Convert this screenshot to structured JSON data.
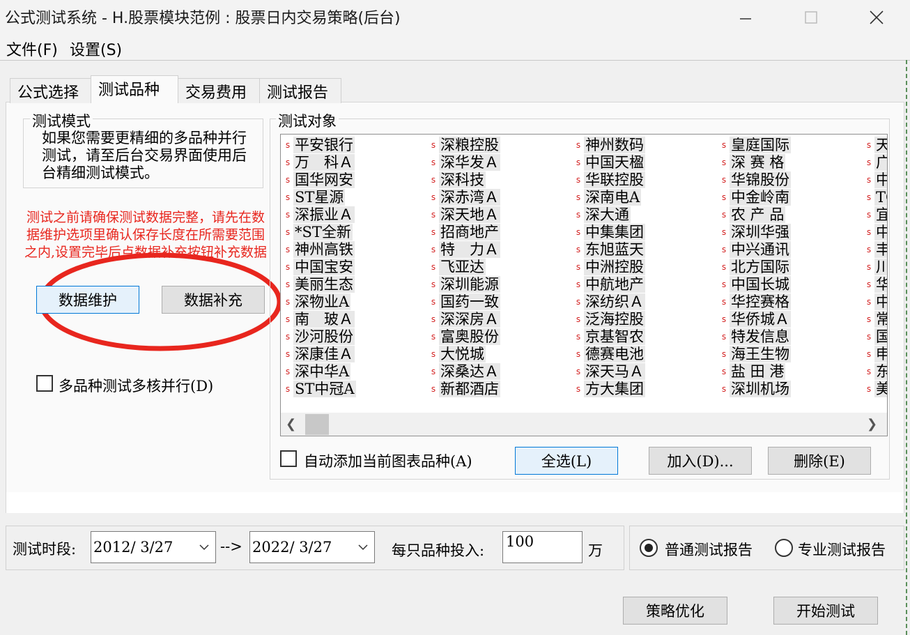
{
  "window": {
    "title": "公式测试系统 - H.股票模块范例 : 股票日内交易策略(后台)",
    "controls": [
      "minimize-icon",
      "maximize-icon",
      "close-icon"
    ]
  },
  "menu": {
    "file": "文件(F)",
    "settings": "设置(S)"
  },
  "tabs": [
    {
      "label": "公式选择",
      "active": false
    },
    {
      "label": "测试品种",
      "active": true
    },
    {
      "label": "交易费用",
      "active": false
    },
    {
      "label": "测试报告",
      "active": false
    }
  ],
  "mode": {
    "title": "测试模式",
    "description": "如果您需要更精细的多品种并行测试，请至后台交易界面使用后台精细测试模式。"
  },
  "notice": "测试之前请确保测试数据完整，请先在数据维护选项里确认保存长度在所需要范围之内,设置完毕后点数据补充按钮补充数据",
  "buttons": {
    "maintain": "数据维护",
    "supplement": "数据补充",
    "select_all": "全选(L)",
    "add": "加入(D)...",
    "delete": "删除(E)",
    "optimize": "策略优化",
    "start": "开始测试"
  },
  "multi_core": {
    "label": "多品种测试多核并行(D)",
    "checked": false
  },
  "objects": {
    "title": "测试对象",
    "mark": "s",
    "columns": [
      [
        "平安银行",
        "万　科Ａ",
        "国华网安",
        "ST星源",
        "深振业Ａ",
        "*ST全新",
        "神州高铁",
        "中国宝安",
        "美丽生态",
        "深物业A",
        "南　玻Ａ",
        "沙河股份",
        "深康佳Ａ",
        "深中华A",
        "ST中冠A"
      ],
      [
        "深粮控股",
        "深华发Ａ",
        "深科技",
        "深赤湾Ａ",
        "深天地Ａ",
        "招商地产",
        "特　力Ａ",
        "飞亚达",
        "深圳能源",
        "国药一致",
        "深深房Ａ",
        "富奥股份",
        "大悦城",
        "深桑达Ａ",
        "新都酒店"
      ],
      [
        "神州数码",
        "中国天楹",
        "华联控股",
        "深南电A",
        "深大通",
        "中集集团",
        "东旭蓝天",
        "中洲控股",
        "中航地产",
        "深纺织Ａ",
        "泛海控股",
        "京基智农",
        "德赛电池",
        "深天马Ａ",
        "方大集团"
      ],
      [
        "皇庭国际",
        "深 赛 格",
        "华锦股份",
        "中金岭南",
        "农 产 品",
        "深圳华强",
        "中兴通讯",
        "北方国际",
        "中国长城",
        "华控赛格",
        "华侨城Ａ",
        "特发信息",
        "海王生物",
        "盐 田 港",
        "深圳机场"
      ],
      [
        "天",
        "广",
        "中",
        "TC",
        "宜",
        "中",
        "丰",
        "川",
        "华",
        "中",
        "常",
        "国",
        "申",
        "东",
        "美"
      ]
    ]
  },
  "auto_add": {
    "label": "自动添加当前图表品种(A)",
    "checked": false
  },
  "period": {
    "label": "测试时段:",
    "start": "2012/ 3/27",
    "arrow": "-->",
    "end": "2022/ 3/27"
  },
  "investment": {
    "label": "每只品种投入:",
    "value": "100",
    "unit": "万"
  },
  "report": {
    "normal_label": "普通测试报告",
    "pro_label": "专业测试报告",
    "selected": "normal"
  },
  "annotation_color": "#e8261e"
}
